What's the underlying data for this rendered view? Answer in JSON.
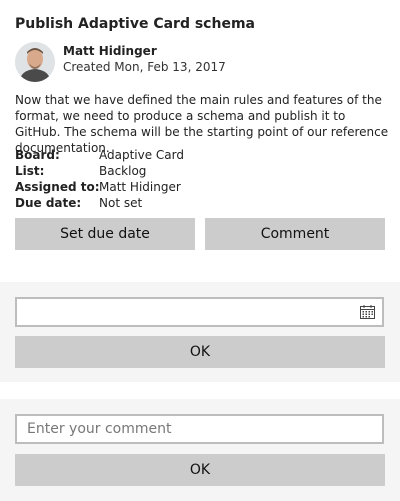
{
  "card": {
    "title": "Publish Adaptive Card schema",
    "author": "Matt Hidinger",
    "created": "Created Mon, Feb 13, 2017",
    "description": "Now that we have defined the main rules and features of the format, we need to produce a schema and publish it to GitHub. The schema will be the starting point of our reference documentation.",
    "facts": [
      {
        "title": "Board:",
        "value": "Adaptive Card"
      },
      {
        "title": "List:",
        "value": "Backlog"
      },
      {
        "title": "Assigned to:",
        "value": "Matt Hidinger"
      },
      {
        "title": "Due date:",
        "value": "Not set"
      }
    ],
    "actions": {
      "set_due_date": "Set due date",
      "comment": "Comment"
    }
  },
  "due_date_panel": {
    "date_value": "",
    "ok_label": "OK"
  },
  "comment_panel": {
    "placeholder": "Enter your comment",
    "ok_label": "OK"
  },
  "colors": {
    "button_bg": "#cccccc",
    "panel_bg": "#f5f5f5",
    "input_border": "#bdbdbd"
  }
}
